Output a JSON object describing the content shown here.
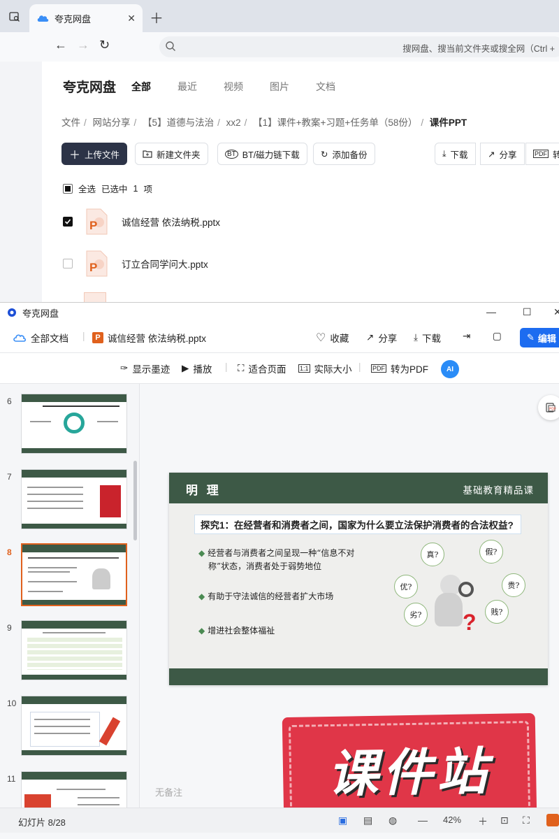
{
  "browser": {
    "tab_title": "夸克网盘",
    "address_placeholder": "搜网盘、搜当前文件夹或搜全网（Ctrl +"
  },
  "page": {
    "brand": "夸克网盘",
    "nav_tabs": [
      {
        "label": "全部",
        "active": true
      },
      {
        "label": "最近",
        "active": false
      },
      {
        "label": "视频",
        "active": false
      },
      {
        "label": "图片",
        "active": false
      },
      {
        "label": "文档",
        "active": false
      }
    ],
    "breadcrumb": [
      "文件",
      "网站分享",
      "【5】道德与法治",
      "xx2",
      "【1】课件+教案+习题+任务单（58份）",
      "课件PPT"
    ],
    "actions": {
      "upload": "上传文件",
      "new_folder": "新建文件夹",
      "bt": "BT/磁力链下载",
      "backup": "添加备份",
      "download": "下载",
      "share": "分享",
      "convert": "转为"
    },
    "select_all": "全选",
    "selected_text": "已选中",
    "selected_count": "1",
    "selected_unit": "项",
    "files": [
      {
        "name": "诚信经营 依法纳税.pptx",
        "checked": true
      },
      {
        "name": "订立合同学问大.pptx",
        "checked": false
      }
    ]
  },
  "viewer": {
    "window_title": "夸克网盘",
    "all_docs": "全部文档",
    "file_name": "诚信经营 依法纳税.pptx",
    "favorite": "收藏",
    "share": "分享",
    "download": "下载",
    "edit": "编辑",
    "show_ink": "显示墨迹",
    "play": "播放",
    "fit_page": "适合页面",
    "actual_size": "实际大小",
    "to_pdf": "转为PDF",
    "ai_label": "AI",
    "thumb_numbers": [
      "6",
      "7",
      "8",
      "9",
      "10",
      "11"
    ],
    "selected_thumb": "8",
    "notes": "无备注",
    "slide_counter": "幻灯片 8/28",
    "zoom": "42%"
  },
  "slide": {
    "title": "明 理",
    "right_title": "基础教育精品课",
    "question": "探究1：在经营者和消费者之间，国家为什么要立法保护消费者的合法权益?",
    "bullets": [
      "经营者与消费者之间呈现一种“信息不对",
      "称”状态，消费者处于弱势地位",
      "有助于守法诚信的经营者扩大市场",
      "增进社会整体福祉"
    ],
    "bubbles": [
      "真?",
      "假?",
      "优?",
      "贵?",
      "劣?",
      "贱?"
    ]
  },
  "watermark": "课件站",
  "colors": {
    "slide_green": "#3d5946",
    "accent_orange": "#e0611d",
    "primary_blue": "#1d6cf0",
    "stamp_red": "#e03648"
  }
}
